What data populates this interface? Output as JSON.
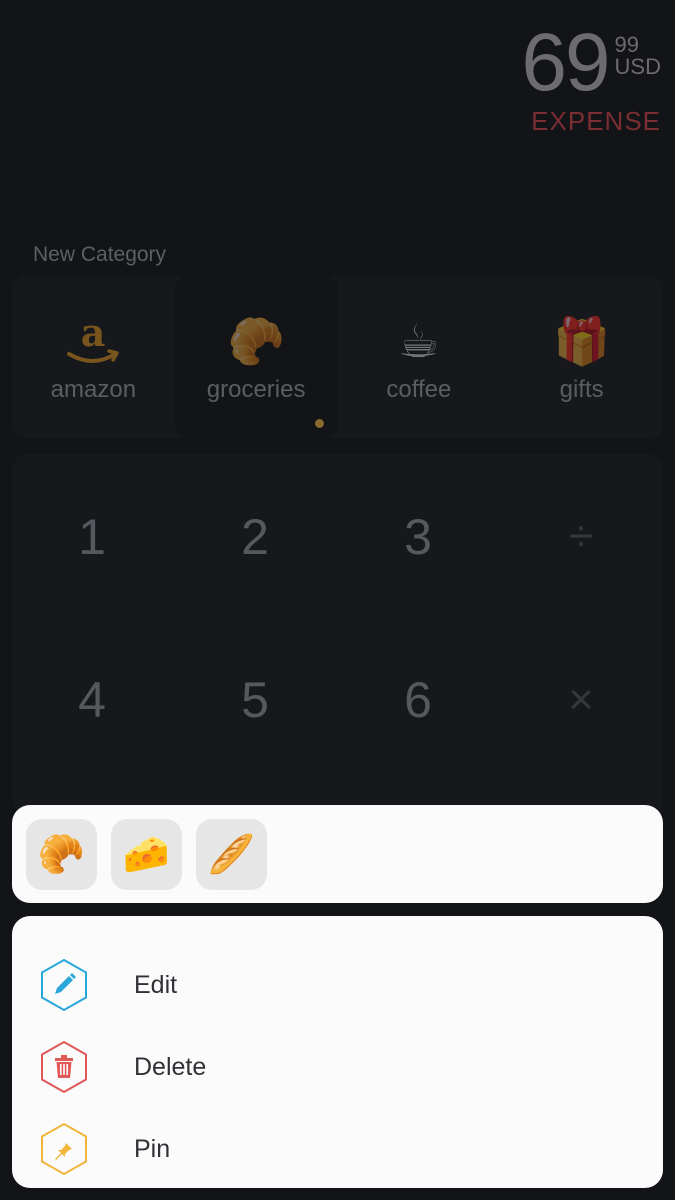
{
  "amount": {
    "main": "69",
    "cents": "99",
    "currency": "USD",
    "type": "EXPENSE",
    "type_color": "#7a2e33"
  },
  "categories": {
    "heading": "New Category",
    "items": [
      {
        "label": "amazon",
        "icon": "amazon-logo-icon"
      },
      {
        "label": "groceries",
        "icon": "🥐",
        "selected": true
      },
      {
        "label": "coffee",
        "icon": "☕"
      },
      {
        "label": "gifts",
        "icon": "🎁"
      }
    ]
  },
  "keypad": {
    "keys": [
      "1",
      "2",
      "3",
      "÷",
      "4",
      "5",
      "6",
      "×"
    ]
  },
  "emoji_options": [
    "🥐",
    "🧀",
    "🥖"
  ],
  "actions": [
    {
      "label": "Edit",
      "icon": "pencil-icon",
      "color": "#2aa7d8"
    },
    {
      "label": "Delete",
      "icon": "trash-icon",
      "color": "#e05858"
    },
    {
      "label": "Pin",
      "icon": "pin-icon",
      "color": "#f0b63c"
    }
  ]
}
